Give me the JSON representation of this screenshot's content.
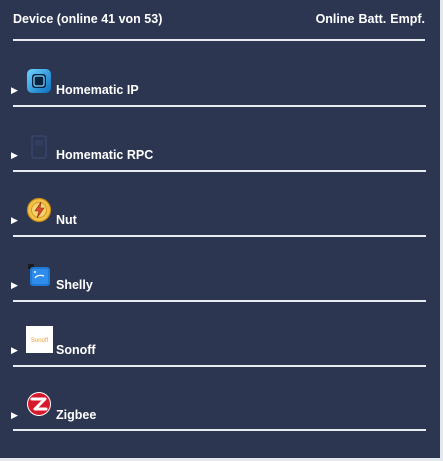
{
  "header": {
    "title": "Device (online 41 von 53)",
    "col_online": "Online",
    "col_batt": "Batt.",
    "col_empf": "Empf."
  },
  "groups": [
    {
      "label": "Homematic IP",
      "icon": "homematic-ip-icon"
    },
    {
      "label": "Homematic RPC",
      "icon": "homematic-rpc-icon"
    },
    {
      "label": "Nut",
      "icon": "nut-icon"
    },
    {
      "label": "Shelly",
      "icon": "shelly-icon"
    },
    {
      "label": "Sonoff",
      "icon": "sonoff-icon",
      "icon_text": "Sonoff"
    },
    {
      "label": "Zigbee",
      "icon": "zigbee-icon"
    }
  ],
  "colors": {
    "background": "#2c3650",
    "rule": "#e8ebf0",
    "text": "#ffffff"
  }
}
